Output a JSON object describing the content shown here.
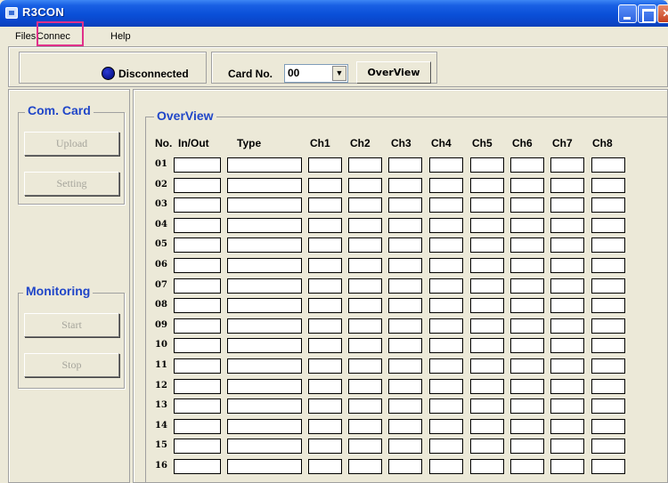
{
  "window": {
    "title": "R3CON"
  },
  "menu": {
    "items": [
      "Files",
      "Connec",
      "Help"
    ]
  },
  "toolbar": {
    "status_text": "Disconnected",
    "status_color": "#0b1690",
    "card_label": "Card No.",
    "card_value": "00",
    "overview_button": "OverView"
  },
  "com_card": {
    "title": "Com. Card",
    "upload_button": "Upload",
    "setting_button": "Setting"
  },
  "monitoring": {
    "title": "Monitoring",
    "start_button": "Start",
    "stop_button": "Stop"
  },
  "overview": {
    "title": "OverView",
    "headers": [
      "No.",
      "In/Out",
      "Type",
      "Ch1",
      "Ch2",
      "Ch3",
      "Ch4",
      "Ch5",
      "Ch6",
      "Ch7",
      "Ch8"
    ],
    "rows": [
      "01",
      "02",
      "03",
      "04",
      "05",
      "06",
      "07",
      "08",
      "09",
      "10",
      "11",
      "12",
      "13",
      "14",
      "15",
      "16"
    ]
  },
  "colors": {
    "accent": "#2046c8",
    "highlight_box": "#e0308a",
    "disabled_text": "#a6a59c"
  }
}
